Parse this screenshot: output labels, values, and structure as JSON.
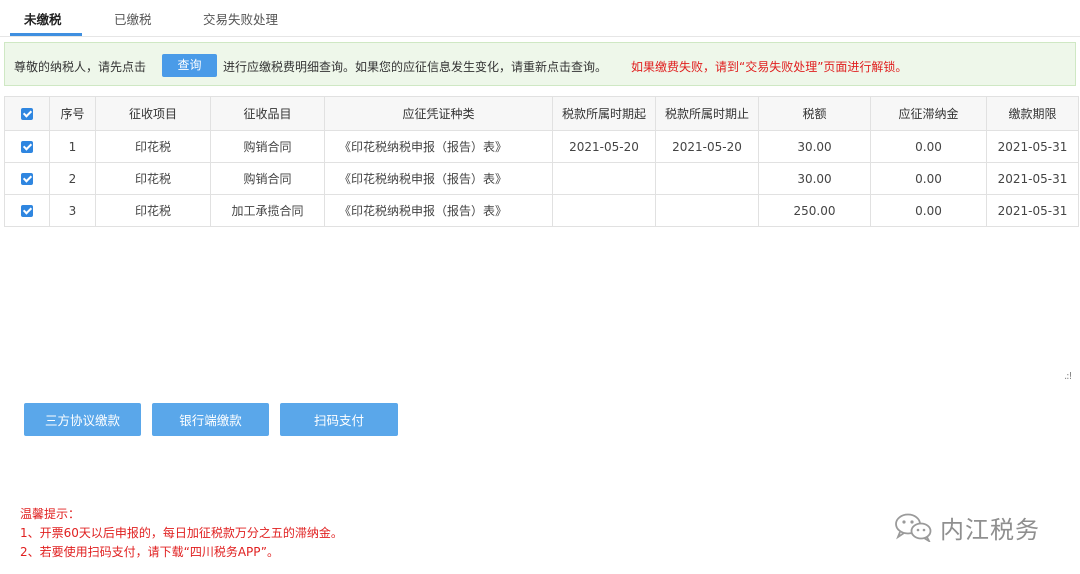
{
  "tabs": [
    {
      "label": "未缴税",
      "active": true
    },
    {
      "label": "已缴税",
      "active": false
    },
    {
      "label": "交易失败处理",
      "active": false
    }
  ],
  "notice": {
    "text_before": "尊敬的纳税人，请先点击",
    "query_button": "查询",
    "text_after": "进行应缴税费明细查询。如果您的应征信息发生变化，请重新点击查询。",
    "warning": "如果缴费失败，请到“交易失败处理”页面进行解锁。"
  },
  "table": {
    "headers": [
      "序号",
      "征收项目",
      "征收品目",
      "应征凭证种类",
      "税款所属时期起",
      "税款所属时期止",
      "税额",
      "应征滞纳金",
      "缴款期限"
    ],
    "rows": [
      {
        "checked": true,
        "no": "1",
        "item": "印花税",
        "category": "购销合同",
        "voucher": "《印花税纳税申报（报告）表》",
        "start": "2021-05-20",
        "end": "2021-05-20",
        "amount": "30.00",
        "late_fee": "0.00",
        "deadline": "2021-05-31"
      },
      {
        "checked": true,
        "no": "2",
        "item": "印花税",
        "category": "购销合同",
        "voucher": "《印花税纳税申报（报告）表》",
        "start": "",
        "end": "",
        "amount": "30.00",
        "late_fee": "0.00",
        "deadline": "2021-05-31"
      },
      {
        "checked": true,
        "no": "3",
        "item": "印花税",
        "category": "加工承揽合同",
        "voucher": "《印花税纳税申报（报告）表》",
        "start": "",
        "end": "",
        "amount": "250.00",
        "late_fee": "0.00",
        "deadline": "2021-05-31"
      }
    ]
  },
  "actions": {
    "tripartite": "三方协议缴款",
    "bank": "银行端缴款",
    "qr": "扫码支付"
  },
  "tips": {
    "title": "温馨提示：",
    "line1": "1、开票60天以后申报的，每日加征税款万分之五的滞纳金。",
    "line2": "2、若要使用扫码支付，请下载“四川税务APP”。"
  },
  "watermark": {
    "text": "内江税务",
    "icon": "wechat-icon"
  },
  "colors": {
    "accent": "#4a9be8",
    "warning": "#e02020",
    "notice_bg": "#eef7ea"
  }
}
